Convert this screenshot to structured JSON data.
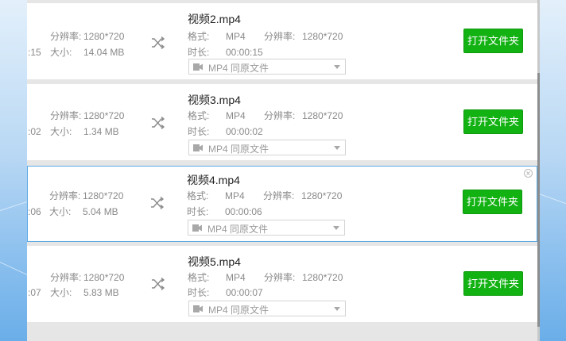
{
  "labels": {
    "resolution": "分辨率:",
    "size": "大小:",
    "format": "格式:",
    "duration": "时长:",
    "open_folder": "打开文件夹"
  },
  "output_format_option": "MP4  同原文件",
  "rows": [
    {
      "left_time_fragment": ":15",
      "src_resolution": "1280*720",
      "src_size": "14.04 MB",
      "out_name": "视频2.mp4",
      "out_format": "MP4",
      "out_resolution": "1280*720",
      "out_duration": "00:00:15"
    },
    {
      "left_time_fragment": ":02",
      "src_resolution": "1280*720",
      "src_size": "1.34 MB",
      "out_name": "视频3.mp4",
      "out_format": "MP4",
      "out_resolution": "1280*720",
      "out_duration": "00:00:02"
    },
    {
      "left_time_fragment": ":06",
      "src_resolution": "1280*720",
      "src_size": "5.04 MB",
      "out_name": "视频4.mp4",
      "out_format": "MP4",
      "out_resolution": "1280*720",
      "out_duration": "00:00:06"
    },
    {
      "left_time_fragment": ":07",
      "src_resolution": "1280*720",
      "src_size": "5.83 MB",
      "out_name": "视频5.mp4",
      "out_format": "MP4",
      "out_resolution": "1280*720",
      "out_duration": "00:00:07"
    }
  ],
  "colors": {
    "open_button": "#13b213",
    "active_border": "#5aa9e6"
  }
}
